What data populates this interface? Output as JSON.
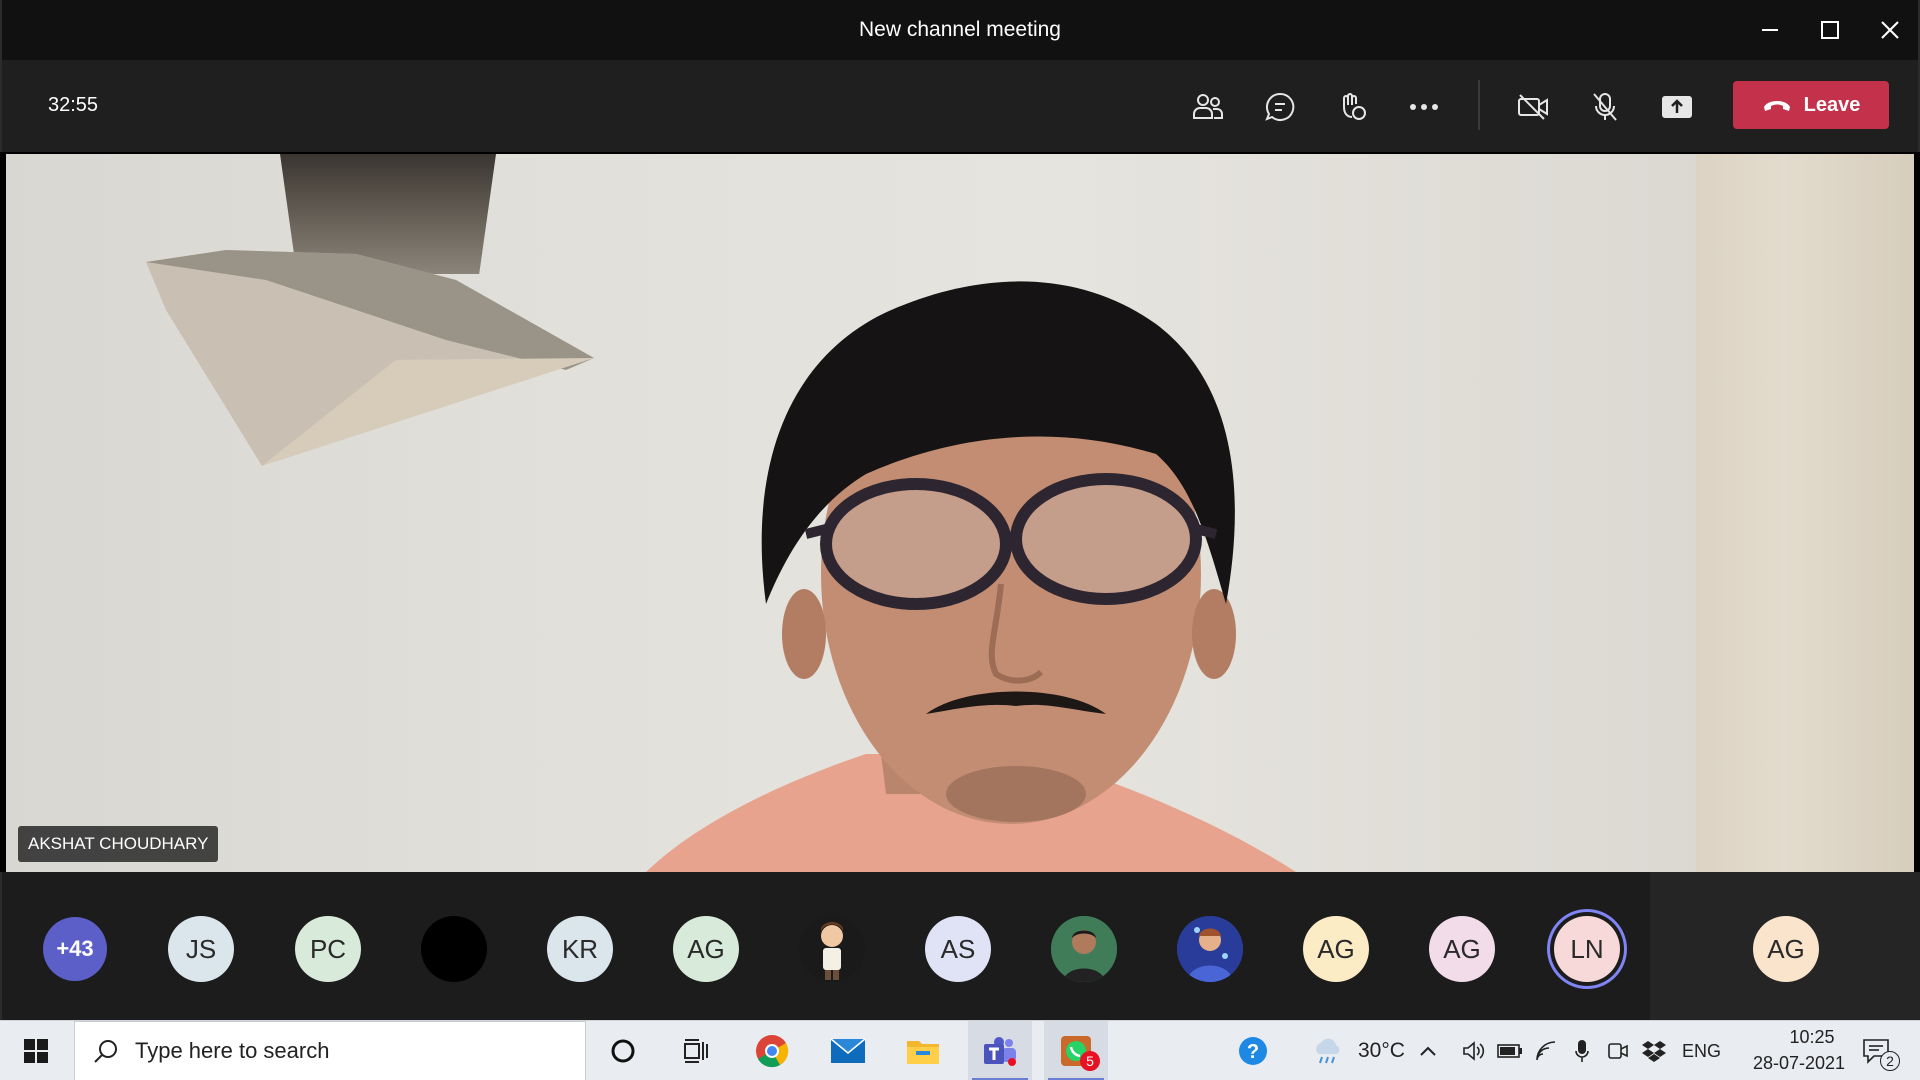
{
  "window": {
    "title": "New channel meeting",
    "minimize_icon": "minimize-icon",
    "maximize_icon": "maximize-icon",
    "close_icon": "close-icon"
  },
  "toolbar": {
    "timer": "32:55",
    "buttons": [
      "people-icon",
      "chat-icon",
      "raise-hand-icon",
      "more-options-icon",
      "camera-off-icon",
      "mic-off-icon",
      "share-screen-icon"
    ],
    "leave_label": "Leave",
    "leave_color": "#c4314b"
  },
  "video": {
    "speaker_name": "AKSHAT CHOUDHARY"
  },
  "participants": [
    {
      "initials": "+43",
      "kind": "overflow",
      "color": "#5b5fc7"
    },
    {
      "initials": "JS",
      "color": "#dbe6ec"
    },
    {
      "initials": "PC",
      "color": "#d8ead9"
    },
    {
      "initials": "",
      "kind": "photo-black",
      "color": "#000000"
    },
    {
      "initials": "KR",
      "color": "#dbe6ec"
    },
    {
      "initials": "AG",
      "color": "#d8ead9"
    },
    {
      "initials": "",
      "kind": "photo-cartoon",
      "color": "#1a1a1a"
    },
    {
      "initials": "AS",
      "color": "#dfe3f5"
    },
    {
      "initials": "",
      "kind": "photo-person",
      "color": "#2e6b4a"
    },
    {
      "initials": "",
      "kind": "photo-blue",
      "color": "#2a3c9a"
    },
    {
      "initials": "AG",
      "color": "#fbecc6"
    },
    {
      "initials": "AG",
      "color": "#f2dcea"
    },
    {
      "initials": "LN",
      "color": "#f8d9d9",
      "speaking": true
    },
    {
      "initials": "AG",
      "color": "#fbe4cc"
    }
  ],
  "taskbar": {
    "search_placeholder": "Type here to search",
    "apps": [
      "windows-start-icon",
      "cortana-icon",
      "task-view-icon",
      "chrome-icon",
      "mail-icon",
      "file-explorer-icon",
      "teams-icon",
      "whatsapp-icon"
    ],
    "whatsapp_badge": "5",
    "weather": "30°C",
    "language": "ENG",
    "time": "10:25",
    "date": "28-07-2021",
    "notifications_badge": "2"
  }
}
